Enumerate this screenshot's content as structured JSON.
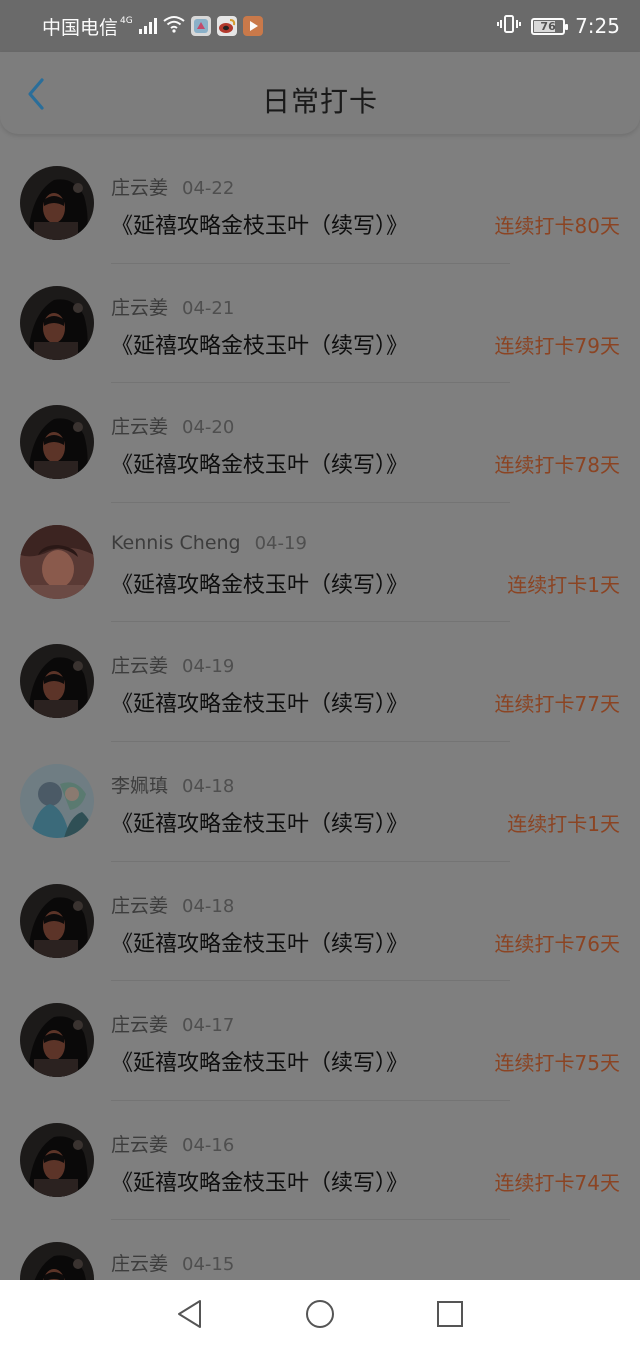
{
  "status_bar": {
    "carrier": "中国电信",
    "network": "4G",
    "battery_level": "76",
    "battery_fraction": 0.76,
    "time": "7:25",
    "icons": [
      "signal-icon",
      "wifi-icon",
      "app-icon",
      "weibo-icon",
      "video-app-icon",
      "vibrate-icon",
      "battery-icon"
    ]
  },
  "header": {
    "title": "日常打卡",
    "back_icon": "chevron-left-icon"
  },
  "colors": {
    "back_arrow": "#2a6e9a",
    "streak_text": "#8b4423",
    "overlay_bg": "#7f7f7f"
  },
  "items": [
    {
      "name": "庄云姜",
      "date": "04-22",
      "title": "《延禧攻略金枝玉叶（续写）》",
      "streak": "连续打卡80天",
      "avatar": "a"
    },
    {
      "name": "庄云姜",
      "date": "04-21",
      "title": "《延禧攻略金枝玉叶（续写）》",
      "streak": "连续打卡79天",
      "avatar": "a"
    },
    {
      "name": "庄云姜",
      "date": "04-20",
      "title": "《延禧攻略金枝玉叶（续写）》",
      "streak": "连续打卡78天",
      "avatar": "a"
    },
    {
      "name": "Kennis Cheng",
      "date": "04-19",
      "title": "《延禧攻略金枝玉叶（续写）》",
      "streak": "连续打卡1天",
      "avatar": "b"
    },
    {
      "name": "庄云姜",
      "date": "04-19",
      "title": "《延禧攻略金枝玉叶（续写）》",
      "streak": "连续打卡77天",
      "avatar": "a"
    },
    {
      "name": "李姵瑱",
      "date": "04-18",
      "title": "《延禧攻略金枝玉叶（续写）》",
      "streak": "连续打卡1天",
      "avatar": "c"
    },
    {
      "name": "庄云姜",
      "date": "04-18",
      "title": "《延禧攻略金枝玉叶（续写）》",
      "streak": "连续打卡76天",
      "avatar": "a"
    },
    {
      "name": "庄云姜",
      "date": "04-17",
      "title": "《延禧攻略金枝玉叶（续写）》",
      "streak": "连续打卡75天",
      "avatar": "a"
    },
    {
      "name": "庄云姜",
      "date": "04-16",
      "title": "《延禧攻略金枝玉叶（续写）》",
      "streak": "连续打卡74天",
      "avatar": "a"
    },
    {
      "name": "庄云姜",
      "date": "04-15",
      "title": "",
      "streak": "",
      "avatar": "a"
    }
  ],
  "nav_bar": {
    "icons": [
      "back-triangle-icon",
      "home-circle-icon",
      "recents-square-icon"
    ]
  }
}
